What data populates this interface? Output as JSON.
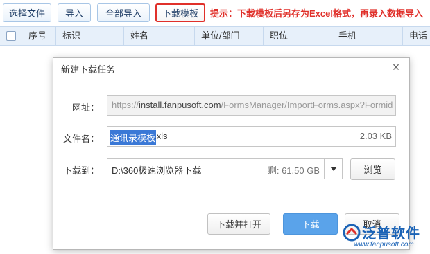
{
  "toolbar": {
    "select_file": "选择文件",
    "import": "导入",
    "import_all": "全部导入",
    "download_template": "下载模板",
    "tip": "提示：下载模板后另存为Excel格式，再录入数据导入"
  },
  "grid": {
    "columns": [
      "序号",
      "标识",
      "姓名",
      "单位/部门",
      "职位",
      "手机",
      "电话"
    ]
  },
  "dialog": {
    "title": "新建下载任务",
    "close_symbol": "×",
    "url_label": "网址：",
    "url_prefix": "https://",
    "url_host": "install.fanpusoft.com",
    "url_rest": "/FormsManager/ImportForms.aspx?Formid",
    "filename_label": "文件名：",
    "filename_selected": "通讯录模板",
    "filename_ext": ".xls",
    "file_size": "2.03 KB",
    "downloadto_label": "下载到：",
    "download_path": "D:\\360极速浏览器下载",
    "free_space": "剩: 61.50 GB",
    "browse": "浏览",
    "download_and_open": "下载并打开",
    "download": "下载",
    "cancel": "取消"
  },
  "watermark": {
    "brand": "泛普软件",
    "url": "www.fanpusoft.com"
  },
  "colors": {
    "accent": "#5aa3ea",
    "tip_red": "#e0302a",
    "header_bg": "#e7f0fa",
    "selection": "#3a78d6",
    "brand_blue": "#1b63b6"
  }
}
